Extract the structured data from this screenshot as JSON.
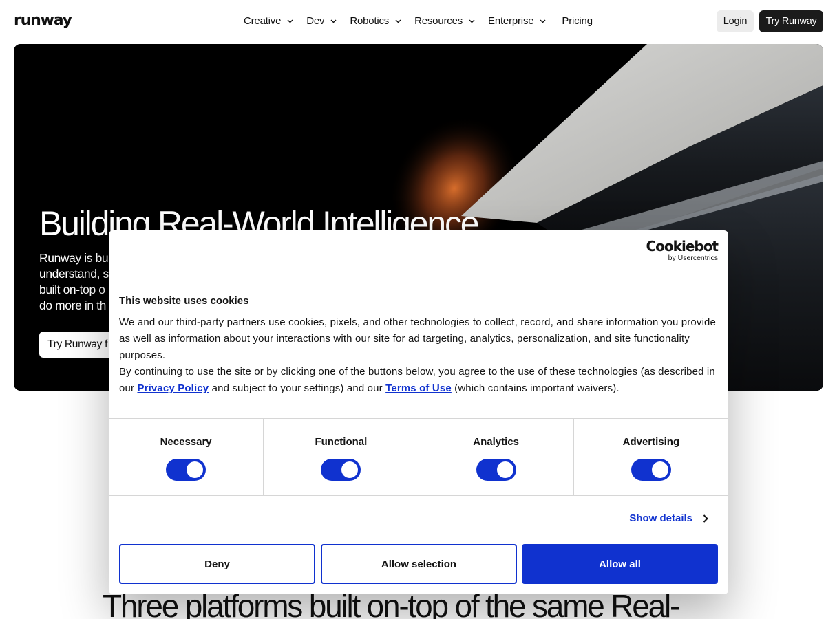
{
  "header": {
    "logo": "runway",
    "nav": [
      {
        "label": "Creative",
        "dropdown": true
      },
      {
        "label": "Dev",
        "dropdown": true
      },
      {
        "label": "Robotics",
        "dropdown": true
      },
      {
        "label": "Resources",
        "dropdown": true
      },
      {
        "label": "Enterprise",
        "dropdown": true
      },
      {
        "label": "Pricing",
        "dropdown": false
      }
    ],
    "login_label": "Login",
    "try_label": "Try Runway"
  },
  "hero": {
    "title": "Building Real-World Intelligence",
    "description_lines": [
      "Runway is bu",
      "understand, s",
      "built on-top o",
      "do more in th"
    ],
    "cta_label": "Try Runway f"
  },
  "bottom": {
    "heading": "Three platforms built on-top of the same Real-"
  },
  "cookie": {
    "brand_name": "Cookiebot",
    "brand_by": "by Usercentrics",
    "title": "This website uses cookies",
    "para1": "We and our third-party partners use cookies, pixels, and other technologies to collect, record, and share information you provide as well as information about your interactions with our site for ad targeting, analytics, personalization, and site functionality purposes.",
    "para2_before": "By continuing to use the site or by clicking one of the buttons below, you agree to the use of these technologies (as described in our ",
    "privacy_link": "Privacy Policy",
    "para2_middle": " and subject to your settings) and our ",
    "terms_link": "Terms of Use",
    "para2_after": " (which contains important waivers).",
    "categories": [
      {
        "label": "Necessary",
        "enabled": true
      },
      {
        "label": "Functional",
        "enabled": true
      },
      {
        "label": "Analytics",
        "enabled": true
      },
      {
        "label": "Advertising",
        "enabled": true
      }
    ],
    "show_details": "Show details",
    "deny_label": "Deny",
    "allow_selection_label": "Allow selection",
    "allow_all_label": "Allow all",
    "accent_color": "#1032cf"
  }
}
